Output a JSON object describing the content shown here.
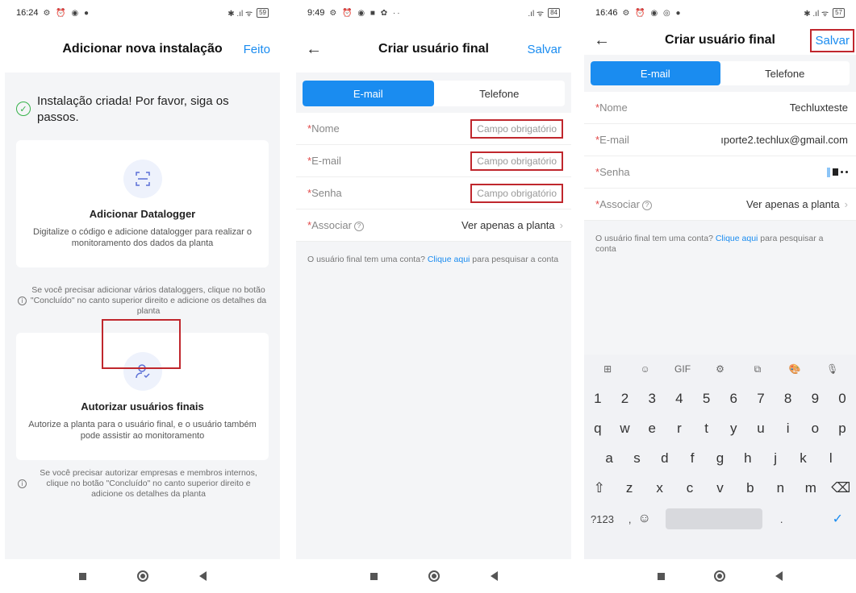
{
  "phone1": {
    "status": {
      "time": "16:24",
      "icons": "⚙ ⏰ ◉ ●",
      "signal": "✱ .ıl ᯤ",
      "battery": "59"
    },
    "header": {
      "title": "Adicionar nova instalação",
      "action": "Feito"
    },
    "success_text": "Instalação criada! Por favor, siga os passos.",
    "card1": {
      "title": "Adicionar Datalogger",
      "desc": "Digitalize o código e adicione datalogger para realizar o monitoramento dos dados da planta"
    },
    "note1": "Se você precisar adicionar vários dataloggers, clique no botão \"Concluído\" no canto superior direito e adicione os detalhes da planta",
    "card2": {
      "title": "Autorizar usuários finais",
      "desc": "Autorize a planta para o usuário final, e o usuário também pode assistir ao monitoramento"
    },
    "note2": "Se você precisar autorizar empresas e membros internos, clique no botão \"Concluído\" no canto superior direito e adicione os detalhes da planta"
  },
  "phone2": {
    "status": {
      "time": "9:49",
      "icons": "⚙ ⏰ ◉ ■ ✿ ··",
      "signal": ".ıl ᯤ",
      "battery": "84"
    },
    "header": {
      "title": "Criar usuário final",
      "action": "Salvar"
    },
    "tabs": [
      "E-mail",
      "Telefone"
    ],
    "fields": {
      "nome": {
        "label": "Nome",
        "placeholder": "Campo obrigatório"
      },
      "email": {
        "label": "E-mail",
        "placeholder": "Campo obrigatório"
      },
      "senha": {
        "label": "Senha",
        "placeholder": "Campo obrigatório"
      },
      "associar": {
        "label": "Associar",
        "value": "Ver apenas a planta"
      }
    },
    "hint": {
      "before": "O usuário final tem uma conta? ",
      "link": "Clique aqui",
      "after": " para pesquisar a conta"
    }
  },
  "phone3": {
    "status": {
      "time": "16:46",
      "icons": "⚙ ⏰ ◉ ◎ ●",
      "signal": "✱ .ıl ᯤ",
      "battery": "57"
    },
    "header": {
      "title": "Criar usuário final",
      "action": "Salvar"
    },
    "tabs": [
      "E-mail",
      "Telefone"
    ],
    "fields": {
      "nome": {
        "label": "Nome",
        "value": "Techluxteste"
      },
      "email": {
        "label": "E-mail",
        "value": "ıporte2.techlux@gmail.com"
      },
      "senha": {
        "label": "Senha"
      },
      "associar": {
        "label": "Associar",
        "value": "Ver apenas a planta"
      }
    },
    "hint": {
      "before": "O usuário final tem uma conta? ",
      "link": "Clique aqui",
      "after": " para pesquisar a conta"
    },
    "keyboard": {
      "tools": [
        "⊞",
        "☺",
        "GIF",
        "⚙",
        "⧉",
        "🎨",
        "🎙"
      ],
      "numbers": [
        "1",
        "2",
        "3",
        "4",
        "5",
        "6",
        "7",
        "8",
        "9",
        "0"
      ],
      "row1": [
        "q",
        "w",
        "e",
        "r",
        "t",
        "y",
        "u",
        "i",
        "o",
        "p"
      ],
      "row2": [
        "a",
        "s",
        "d",
        "f",
        "g",
        "h",
        "j",
        "k",
        "l"
      ],
      "row3": [
        "⇧",
        "z",
        "x",
        "c",
        "v",
        "b",
        "n",
        "m",
        "⌫"
      ],
      "bottom": {
        "sym": "?123",
        "comma": ",",
        "emoji": "☺",
        "period": ".",
        "enter": "✓"
      }
    }
  },
  "colors": {
    "accent": "#1a8cf0",
    "highlight": "#c0272d",
    "success": "#36b24a"
  }
}
